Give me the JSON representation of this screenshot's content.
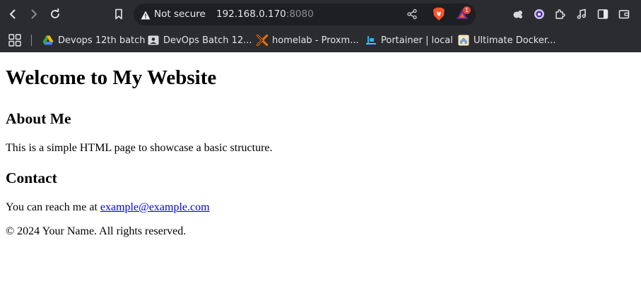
{
  "browser": {
    "security_label": "Not secure",
    "url_host": "192.168.0.170",
    "url_port": ":8080",
    "rewards_badge": "1",
    "bookmarks": [
      {
        "label": "Devops 12th batch",
        "icon": "google-drive-icon"
      },
      {
        "label": "DevOps Batch 12...",
        "icon": "classroom-icon"
      },
      {
        "label": "homelab - Proxm...",
        "icon": "proxmox-icon"
      },
      {
        "label": "Portainer | local",
        "icon": "portainer-icon"
      },
      {
        "label": "Ultimate Docker...",
        "icon": "docker-guide-icon"
      }
    ]
  },
  "page": {
    "title": "Welcome to My Website",
    "about_heading": "About Me",
    "about_text": "This is a simple HTML page to showcase a basic structure.",
    "contact_heading": "Contact",
    "contact_prefix": "You can reach me at ",
    "contact_email": "example@example.com",
    "footer": "© 2024 Your Name. All rights reserved."
  },
  "colors": {
    "chrome_bg": "#2b2c30",
    "omnibox_bg": "#1e1f22",
    "link": "#0000ee"
  }
}
